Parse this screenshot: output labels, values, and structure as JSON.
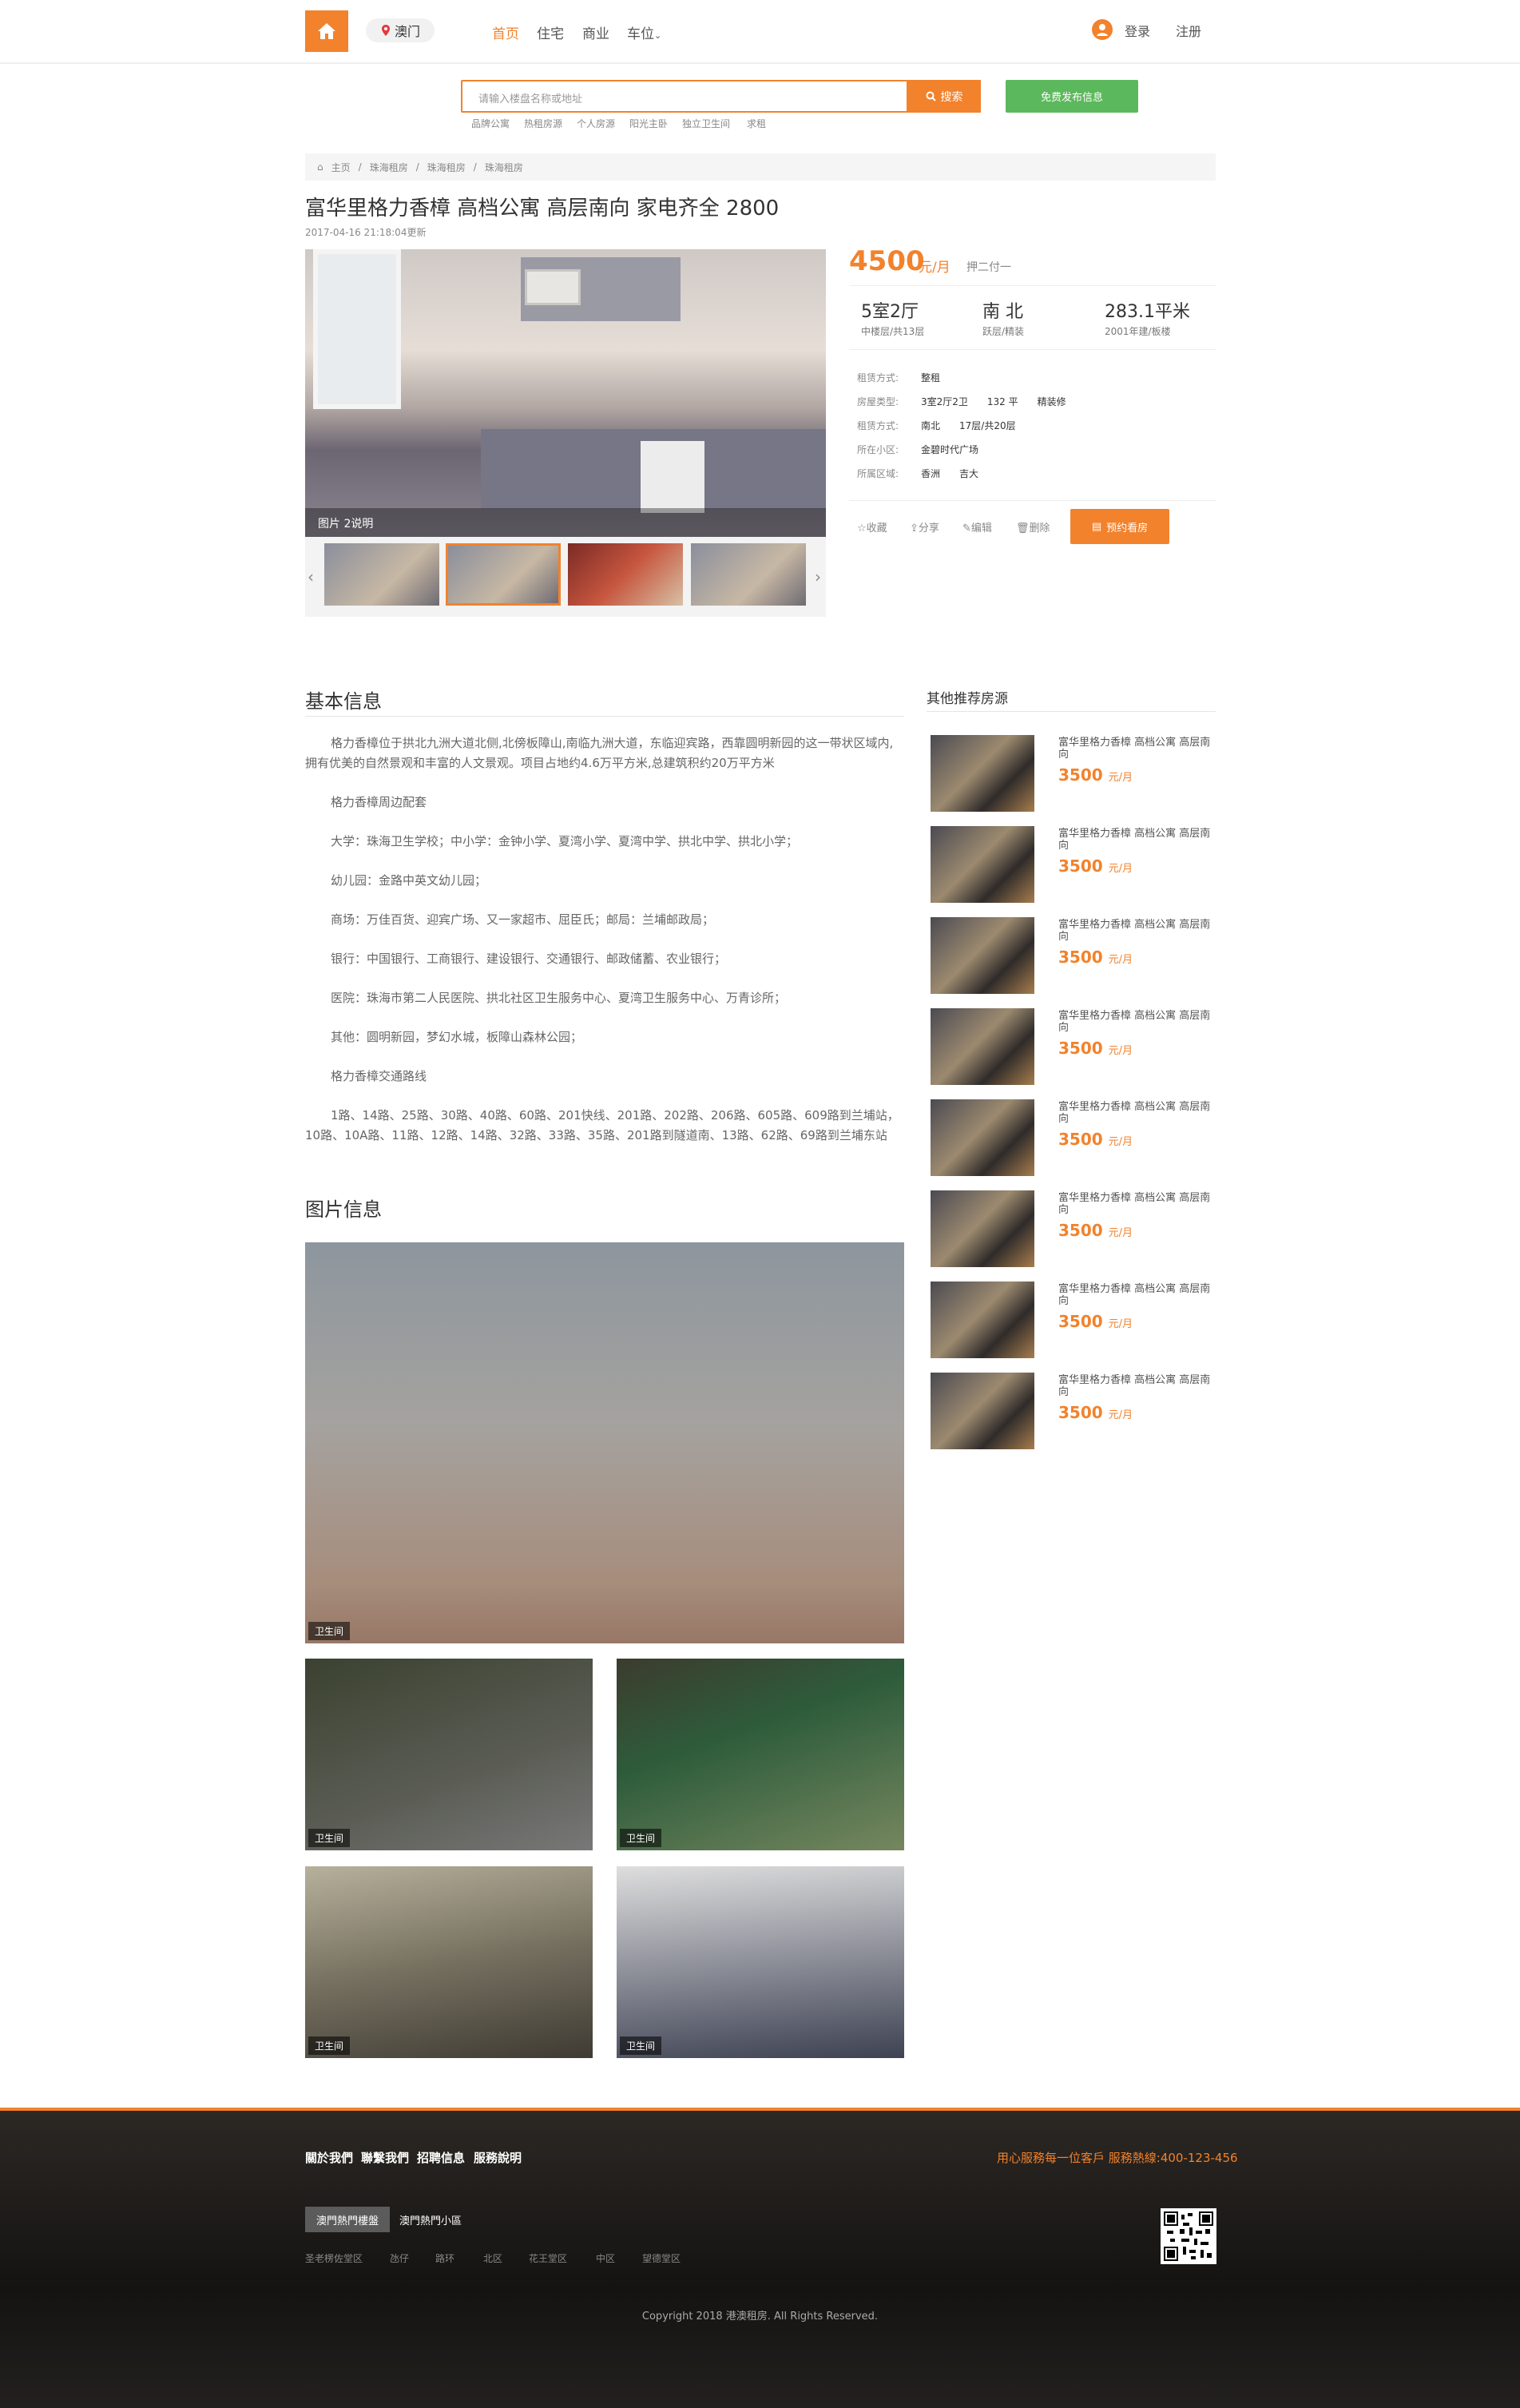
{
  "header": {
    "city": "澳门",
    "nav": [
      "首页",
      "住宅",
      "商业",
      "车位"
    ],
    "login": "登录",
    "register": "注册",
    "accent": "#f2822c"
  },
  "search": {
    "placeholder": "请输入楼盘名称或地址",
    "button": "搜索",
    "publish": "免费发布信息",
    "hot": [
      "品牌公寓",
      "热租房源",
      "个人房源",
      "阳光主卧",
      "独立卫生间",
      "求租"
    ]
  },
  "breadcrumb": [
    "主页",
    "珠海租房",
    "珠海租房",
    "珠海租房"
  ],
  "listing": {
    "title": "富华里格力香樟 高档公寓 高层南向 家电齐全 2800",
    "updated": "2017-04-16 21:18:04更新",
    "caption": "图片 2说明",
    "price": "4500",
    "price_unit": "元/月",
    "pay": "押二付一",
    "stats": [
      {
        "big": "5室2厅",
        "small": "中楼层/共13层"
      },
      {
        "big": "南 北",
        "small": "跃层/精装"
      },
      {
        "big": "283.1平米",
        "small": "2001年建/板楼"
      }
    ],
    "details": [
      {
        "label": "租赁方式:",
        "value": "整租"
      },
      {
        "label": "房屋类型:",
        "value": "3室2厅2卫　　132 平　　精装修"
      },
      {
        "label": "租赁方式:",
        "value": "南北　　17层/共20层"
      },
      {
        "label": "所在小区:",
        "value": "金碧时代广场"
      },
      {
        "label": "所属区域:",
        "value": "香洲　　吉大"
      }
    ],
    "actions": [
      "收藏",
      "分享",
      "编辑",
      "删除"
    ],
    "book": "预约看房"
  },
  "basic": {
    "heading": "基本信息",
    "paragraphs": [
      "格力香樟位于拱北九洲大道北侧,北傍板障山,南临九洲大道，东临迎宾路，西靠圆明新园的这一带状区域内,拥有优美的自然景观和丰富的人文景观。项目占地约4.6万平方米,总建筑积约20万平方米",
      "格力香樟周边配套",
      "大学：珠海卫生学校；中小学：金钟小学、夏湾小学、夏湾中学、拱北中学、拱北小学；",
      "幼儿园：金路中英文幼儿园；",
      "商场：万佳百货、迎宾广场、又一家超市、屈臣氏；邮局：兰埔邮政局；",
      "银行：中国银行、工商银行、建设银行、交通银行、邮政储蓄、农业银行；",
      "医院：珠海市第二人民医院、拱北社区卫生服务中心、夏湾卫生服务中心、万青诊所；",
      "其他：圆明新园，梦幻水城，板障山森林公园；",
      "格力香樟交通路线",
      "1路、14路、25路、30路、40路、60路、201快线、201路、202路、206路、605路、609路到兰埔站，10路、10A路、11路、12路、14路、32路、33路、35路、201路到隧道南、13路、62路、69路到兰埔东站"
    ]
  },
  "photos": {
    "heading": "图片信息",
    "items": [
      {
        "tag": "卫生间"
      },
      {
        "tag": "卫生间"
      },
      {
        "tag": "卫生间"
      },
      {
        "tag": "卫生间"
      },
      {
        "tag": "卫生间"
      }
    ]
  },
  "recommend": {
    "heading": "其他推荐房源",
    "items": [
      {
        "title": "富华里格力香樟 高档公寓 高层南向",
        "price": "3500",
        "unit": "元/月"
      },
      {
        "title": "富华里格力香樟 高档公寓 高层南向",
        "price": "3500",
        "unit": "元/月"
      },
      {
        "title": "富华里格力香樟 高档公寓 高层南向",
        "price": "3500",
        "unit": "元/月"
      },
      {
        "title": "富华里格力香樟 高档公寓 高层南向",
        "price": "3500",
        "unit": "元/月"
      },
      {
        "title": "富华里格力香樟 高档公寓 高层南向",
        "price": "3500",
        "unit": "元/月"
      },
      {
        "title": "富华里格力香樟 高档公寓 高层南向",
        "price": "3500",
        "unit": "元/月"
      },
      {
        "title": "富华里格力香樟 高档公寓 高层南向",
        "price": "3500",
        "unit": "元/月"
      },
      {
        "title": "富华里格力香樟 高档公寓 高层南向",
        "price": "3500",
        "unit": "元/月"
      }
    ]
  },
  "footer": {
    "links": [
      "關於我們",
      "聯繫我們",
      "招聘信息",
      "服務說明"
    ],
    "hotline": "用心服務每一位客戶 服務熱線:400-123-456",
    "tabs": [
      "澳門熱門樓盤",
      "澳門熱門小區"
    ],
    "areas": [
      "圣老楞佐堂区",
      "氹仔",
      "路环",
      "北区",
      "花王堂区",
      "中区",
      "望德堂区"
    ],
    "copyright": "Copyright 2018 港澳租房. All Rights Reserved."
  }
}
